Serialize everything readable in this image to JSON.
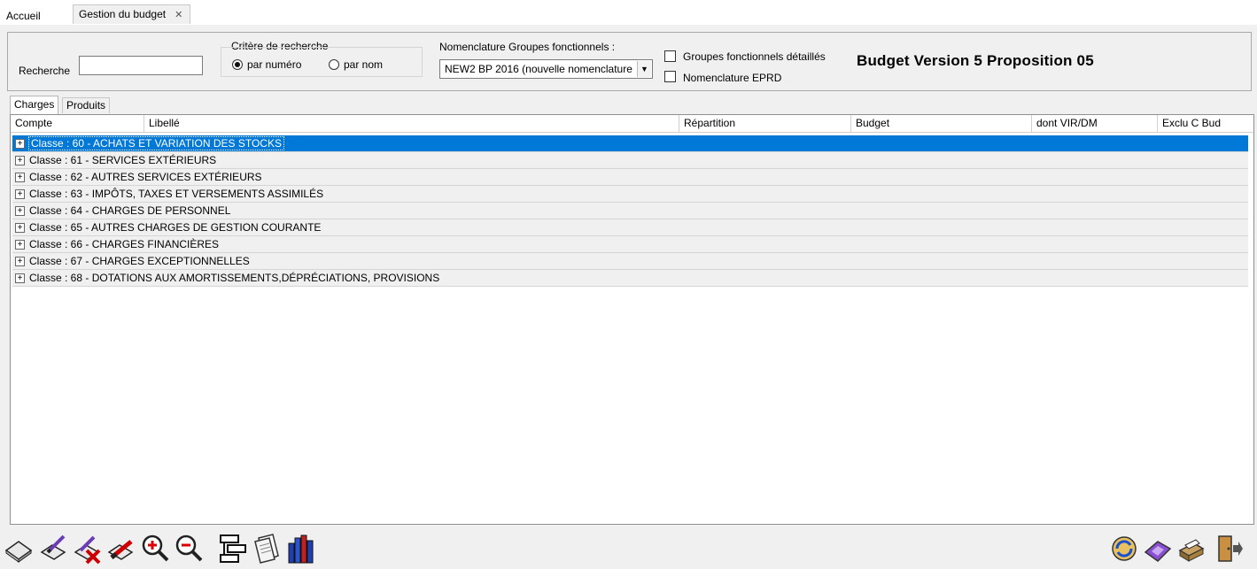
{
  "tabs": {
    "home": "Accueil",
    "active": "Gestion du budget",
    "close": "✕"
  },
  "search": {
    "label": "Recherche",
    "value": "",
    "criteria_title": "Critère de recherche",
    "by_number": "par numéro",
    "by_name": "par nom",
    "selected": "par numéro"
  },
  "nomenclature": {
    "label": "Nomenclature Groupes fonctionnels :",
    "value": "NEW2  BP 2016 (nouvelle nomenclature",
    "detailed_groups": "Groupes fonctionnels détaillés",
    "eprd": "Nomenclature EPRD"
  },
  "budget_title": "Budget Version  5 Proposition 05",
  "subtabs": {
    "charges": "Charges",
    "produits": "Produits"
  },
  "grid": {
    "columns": [
      "Compte",
      "Libellé",
      "Répartition",
      "Budget",
      "dont VIR/DM",
      "Exclu C Bud"
    ],
    "rows": [
      "Classe : 60 - ACHATS ET VARIATION DES STOCKS",
      "Classe : 61 - SERVICES EXTÉRIEURS",
      "Classe : 62 - AUTRES SERVICES EXTÉRIEURS",
      "Classe : 63 - IMPÔTS, TAXES ET VERSEMENTS ASSIMILÉS",
      "Classe : 64 - CHARGES DE PERSONNEL",
      "Classe : 65 - AUTRES CHARGES DE GESTION COURANTE",
      "Classe : 66 - CHARGES FINANCIÈRES",
      "Classe : 67 - CHARGES EXCEPTIONNELLES",
      "Classe : 68 - DOTATIONS AUX AMORTISSEMENTS,DÉPRÉCIATIONS, PROVISIONS"
    ],
    "expander": "+"
  },
  "colors": {
    "selection": "#0078d7"
  },
  "toolbar_icons": [
    "new-icon",
    "edit-icon",
    "edit-delete-icon",
    "delete-icon",
    "zoom-in-icon",
    "zoom-out-icon",
    "tree-icon",
    "document-icon",
    "books-icon"
  ],
  "right_icons": [
    "refresh-icon",
    "tag-icon",
    "print-icon",
    "exit-door-icon"
  ],
  "dropdown_arrow": "▼"
}
